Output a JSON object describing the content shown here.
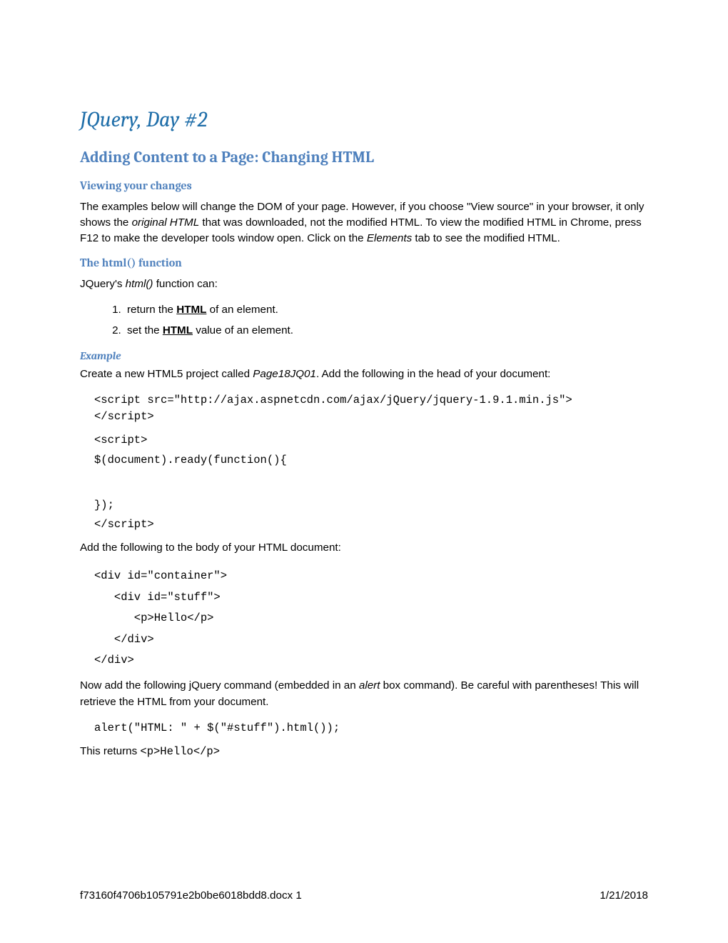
{
  "title": "JQuery, Day #2",
  "section": "Adding Content to a Page: Changing HTML",
  "sub1": {
    "heading": "Viewing your changes",
    "para_parts": {
      "a": "The examples below will change the DOM of your page. However, if you choose \"View source\" in your browser, it only shows the ",
      "b": "original HTML",
      "c": " that was downloaded, not the modified HTML. To view the modified HTML in Chrome, press F12 to make the developer tools window open. Click on the ",
      "d": "Elements",
      "e": " tab to see the modified HTML."
    }
  },
  "sub2": {
    "heading": "The html() function",
    "intro": {
      "a": "JQuery's ",
      "b": "html()",
      "c": " function can:"
    },
    "list": [
      {
        "pre": "return the ",
        "link": "HTML",
        "post": " of an element."
      },
      {
        "pre": "set the ",
        "link": "HTML",
        "post": " value of an element."
      }
    ]
  },
  "example": {
    "heading": "Example",
    "p1": {
      "a": "Create a new HTML5 project called ",
      "b": "Page18JQ01",
      "c": ". Add the following in the head of your document:"
    },
    "code1": "<script src=\"http://ajax.aspnetcdn.com/ajax/jQuery/jquery-1.9.1.min.js\">\n</script>",
    "code2": "<script>",
    "code3": "$(document).ready(function(){",
    "code4": "});",
    "code5": "</script>",
    "p2": "Add the following to the body of your HTML document:",
    "code6": "<div id=\"container\">\n   <div id=\"stuff\">\n      <p>Hello</p>\n   </div>\n</div>",
    "p3": {
      "a": "Now add the following jQuery command (embedded in an ",
      "b": "alert",
      "c": " box command). Be careful with parentheses! This will retrieve the HTML from your document."
    },
    "code7": "alert(\"HTML: \" + $(\"#stuff\").html());",
    "p4": {
      "a": "This returns ",
      "b": "<p>Hello</p>"
    }
  },
  "footer": {
    "left": "f73160f4706b105791e2b0be6018bdd8.docx   1",
    "right": "1/21/2018"
  }
}
